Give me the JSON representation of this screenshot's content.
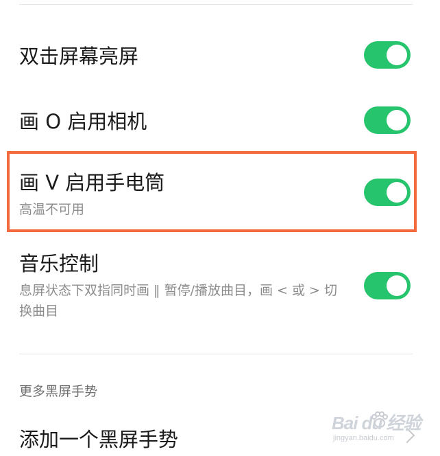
{
  "settings": [
    {
      "title": "双击屏幕亮屏",
      "subtitle": "",
      "enabled": true
    },
    {
      "title": "画 O 启用相机",
      "subtitle": "",
      "enabled": true
    },
    {
      "title": "画 V 启用手电筒",
      "subtitle": "高温不可用",
      "enabled": true
    },
    {
      "title": "音乐控制",
      "subtitle": "息屏状态下双指同时画 ‖ 暂停/播放曲目，画 < 或 > 切换曲目",
      "enabled": true
    }
  ],
  "more_section": {
    "header": "更多黑屏手势",
    "add_item_label": "添加一个黑屏手势"
  },
  "watermark": {
    "brand": "Bai du 经验",
    "url": "jingyan.baidu.com"
  },
  "colors": {
    "toggle_on": "#27c46e",
    "highlight_border": "#f26a3e"
  },
  "icons": {
    "chevron": "chevron-right-icon"
  }
}
